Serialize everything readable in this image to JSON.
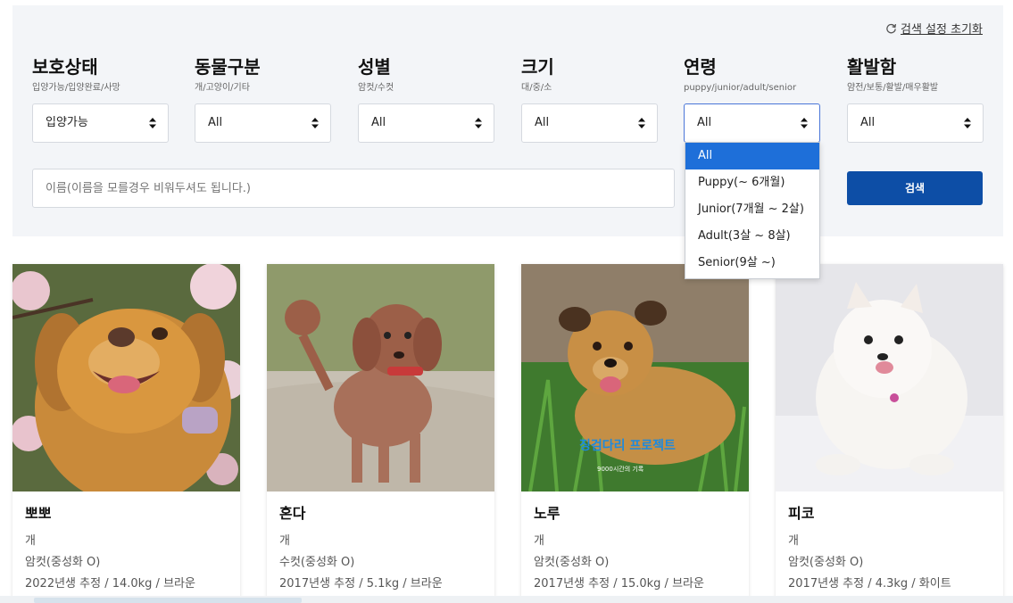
{
  "reset_label": "검색 설정 초기화",
  "filters": [
    {
      "title": "보호상태",
      "subtitle": "입양가능/입양완료/사망",
      "value": "입양가능"
    },
    {
      "title": "동물구분",
      "subtitle": "개/고양이/기타",
      "value": "All"
    },
    {
      "title": "성별",
      "subtitle": "암컷/수컷",
      "value": "All"
    },
    {
      "title": "크기",
      "subtitle": "대/중/소",
      "value": "All"
    },
    {
      "title": "연령",
      "subtitle": "puppy/junior/adult/senior",
      "value": "All"
    },
    {
      "title": "활발함",
      "subtitle": "얌전/보통/활발/매우활발",
      "value": "All"
    }
  ],
  "age_dropdown": {
    "options": [
      "All",
      "Puppy(~ 6개월)",
      "Junior(7개월 ~ 2살)",
      "Adult(3살 ~ 8살)",
      "Senior(9살 ~)"
    ],
    "selected_index": 0
  },
  "search": {
    "placeholder": "이름(이름을 모를경우 비워두셔도 됩니다.)",
    "button_label": "검색"
  },
  "cards": [
    {
      "name": "뽀뽀",
      "species": "개",
      "sex": "암컷(중성화 O)",
      "details": "2022년생 추정 / 14.0kg / 브라운"
    },
    {
      "name": "혼다",
      "species": "개",
      "sex": "수컷(중성화 O)",
      "details": "2017년생 추정 / 5.1kg / 브라운"
    },
    {
      "name": "노루",
      "species": "개",
      "sex": "암컷(중성화 O)",
      "details": "2017년생 추정 / 15.0kg / 브라운",
      "watermark": "징검다리 프로젝트",
      "watermark_sub": "9000시간의 기록"
    },
    {
      "name": "피코",
      "species": "개",
      "sex": "암컷(중성화 O)",
      "details": "2017년생 추정 / 4.3kg / 화이트"
    }
  ],
  "colors": {
    "panel_bg": "#f3f5f8",
    "search_button": "#0d4ea6",
    "dropdown_selected": "#1e6fd9"
  }
}
